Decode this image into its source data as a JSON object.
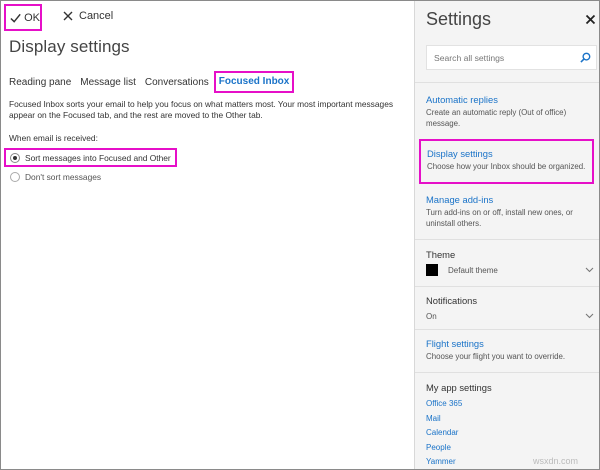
{
  "toolbar": {
    "ok_label": "OK",
    "cancel_label": "Cancel"
  },
  "page": {
    "title": "Display settings"
  },
  "tabs": [
    {
      "label": "Reading pane"
    },
    {
      "label": "Message list"
    },
    {
      "label": "Conversations"
    },
    {
      "label": "Focused Inbox",
      "active": true
    }
  ],
  "focused": {
    "description": "Focused Inbox sorts your email to help you focus on what matters most. Your most important messages appear on the Focused tab, and the rest are moved to the Other tab.",
    "when_label": "When email is received:",
    "options": [
      {
        "label": "Sort messages into Focused and Other",
        "selected": true
      },
      {
        "label": "Don't sort messages",
        "selected": false
      }
    ]
  },
  "settings_panel": {
    "title": "Settings",
    "search_placeholder": "Search all settings",
    "automatic_replies": {
      "title": "Automatic replies",
      "desc": "Create an automatic reply (Out of office) message."
    },
    "display_settings": {
      "title": "Display settings",
      "desc": "Choose how your Inbox should be organized."
    },
    "manage_addins": {
      "title": "Manage add-ins",
      "desc": "Turn add-ins on or off, install new ones, or uninstall others."
    },
    "theme": {
      "heading": "Theme",
      "value": "Default theme",
      "swatch_color": "#000000"
    },
    "notifications": {
      "heading": "Notifications",
      "value": "On"
    },
    "flight_settings": {
      "title": "Flight settings",
      "desc": "Choose your flight you want to override."
    },
    "my_app_settings": {
      "heading": "My app settings",
      "links": [
        "Office 365",
        "Mail",
        "Calendar",
        "People",
        "Yammer"
      ]
    }
  },
  "colors": {
    "accent": "#1a73c8",
    "highlight": "#e60fc8",
    "panel_bg": "#f4f4f4"
  },
  "watermark": "wsxdn.com"
}
